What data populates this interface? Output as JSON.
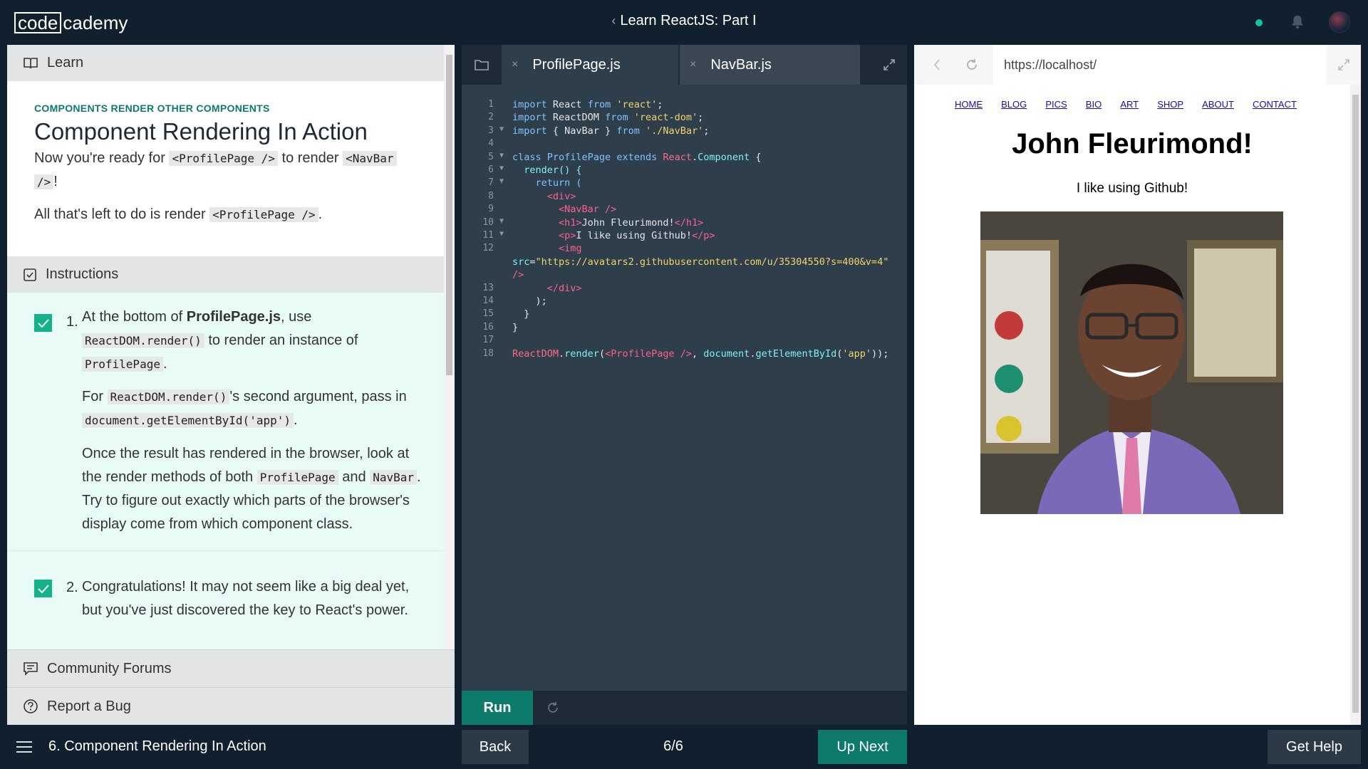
{
  "header": {
    "logo_boxed": "code",
    "logo_rest": "cademy",
    "course_title": "Learn ReactJS: Part I",
    "status_color": "#15c39a"
  },
  "learn": {
    "header_label": "Learn",
    "kicker": "COMPONENTS RENDER OTHER COMPONENTS",
    "title": "Component Rendering In Action",
    "p1_a": "Now you're ready for ",
    "p1_code1": "<ProfilePage />",
    "p1_b": " to render ",
    "p1_code2": "<NavBar",
    "p1_code2b": "/>",
    "p1_c": "!",
    "p2_a": "All that's left to do is render ",
    "p2_code": "<ProfilePage />",
    "p2_b": "."
  },
  "instructions": {
    "header_label": "Instructions",
    "task1": {
      "number": "1.",
      "a": "At the bottom of ",
      "bold": "ProfilePage.js",
      "b": ", use",
      "code1": "ReactDOM.render()",
      "c": " to render an instance of",
      "code2": "ProfilePage",
      "d": ".",
      "p2_a": "For ",
      "p2_code": "ReactDOM.render()",
      "p2_b": "'s second argument, pass in",
      "p2_code2": "document.getElementById('app')",
      "p2_c": ".",
      "p3_a": "Once the result has rendered in the browser, look at the render methods of both ",
      "p3_code1": "ProfilePage",
      "p3_b": " and",
      "p3_code2": "NavBar",
      "p3_c": ". Try to figure out exactly which parts of the browser's display come from which component class."
    },
    "task2": {
      "number": "2.",
      "text": "Congratulations! It may not seem like a big deal yet, but you've just discovered the key to React's power."
    }
  },
  "footer_links": {
    "forums": "Community Forums",
    "bug": "Report a Bug"
  },
  "editor": {
    "tabs": [
      "ProfilePage.js",
      "NavBar.js"
    ],
    "close_glyph": "×",
    "line_numbers": [
      "1",
      "2",
      "3",
      "4",
      "5",
      "6",
      "7",
      "8",
      "9",
      "10",
      "11",
      "12",
      "",
      "13",
      "14",
      "15",
      "16",
      "17",
      "18"
    ],
    "lines": {
      "l1_kw": "import",
      "l1_b": " React ",
      "l1_kw2": "from",
      "l1_str": " 'react'",
      "l1_end": ";",
      "l2_kw": "import",
      "l2_b": " ReactDOM ",
      "l2_kw2": "from",
      "l2_str": " 'react-dom'",
      "l2_end": ";",
      "l3_kw": "import",
      "l3_b": " { NavBar } ",
      "l3_kw2": "from",
      "l3_str": " './NavBar'",
      "l3_end": ";",
      "l5_kw": "class",
      "l5_b": " ProfilePage ",
      "l5_kw2": "extends",
      "l5_react": " React",
      "l5_dot": ".",
      "l5_comp": "Component",
      "l5_end": " {",
      "l6": "  render() {",
      "l7": "    return (",
      "l8": "      <div>",
      "l9": "        <NavBar />",
      "l10_open": "        <h1>",
      "l10_text": "John Fleurimond!",
      "l10_close": "</h1>",
      "l11_open": "        <p>",
      "l11_text": "I like using Github!",
      "l11_close": "</p>",
      "l12": "        <img",
      "l12b_attr": "src",
      "l12b_eq": "=",
      "l12b_str": "\"https://avatars2.githubusercontent.com/u/35304550?s=400&v=4\"",
      "l12c": "/>",
      "l13": "      </div>",
      "l14": "    );",
      "l15": "  }",
      "l16": "}",
      "l18_a": "ReactDOM",
      "l18_b": ".",
      "l18_c": "render",
      "l18_d": "(",
      "l18_e": "<ProfilePage />",
      "l18_f": ", ",
      "l18_g": "document",
      "l18_h": ".",
      "l18_i": "getElementById",
      "l18_j": "(",
      "l18_k": "'app'",
      "l18_l": "));"
    },
    "run_label": "Run"
  },
  "browser": {
    "url": "https://localhost/",
    "nav_links": [
      "HOME",
      "BLOG",
      "PICS",
      "BIO",
      "ART",
      "SHOP",
      "ABOUT",
      "CONTACT"
    ],
    "heading": "John Fleurimond!",
    "paragraph": "I like using Github!"
  },
  "bottom": {
    "crumb": "6. Component Rendering In Action",
    "back": "Back",
    "progress": "6/6",
    "up_next": "Up Next",
    "help": "Get Help"
  }
}
